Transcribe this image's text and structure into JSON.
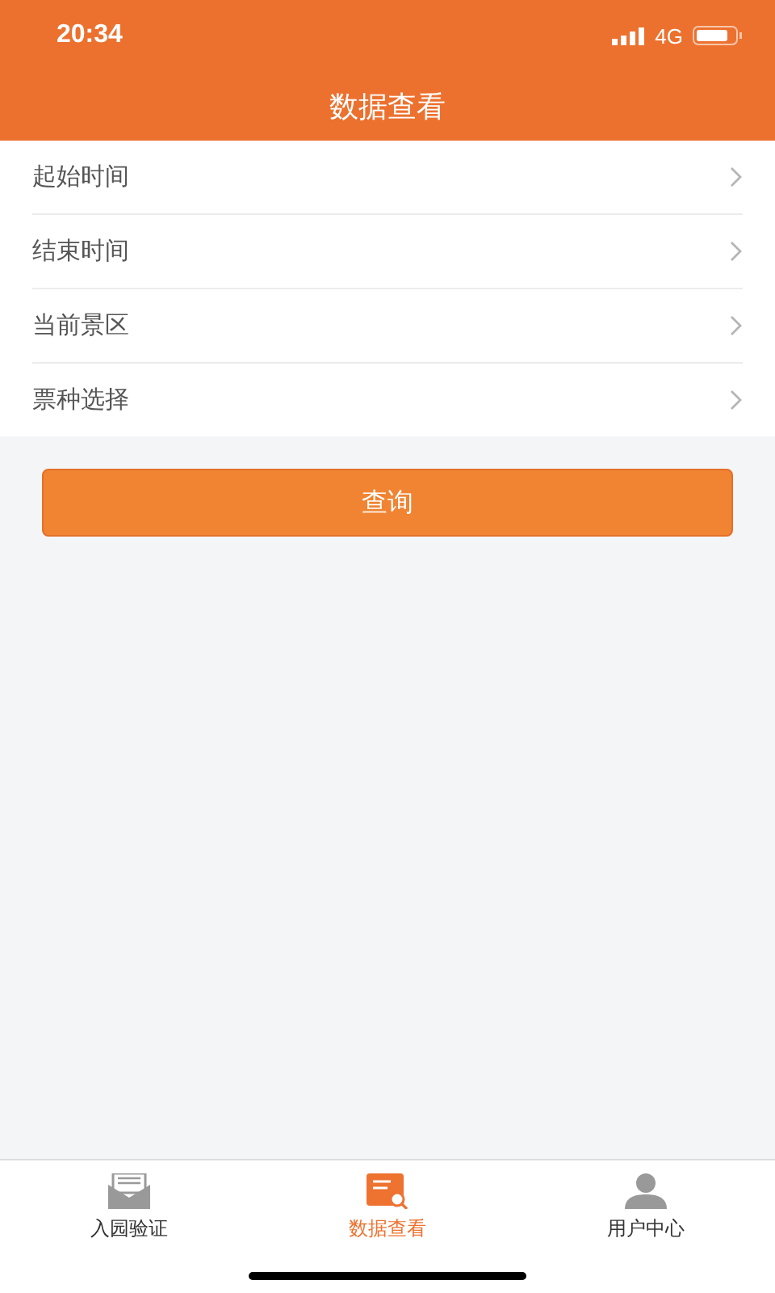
{
  "status_bar": {
    "time": "20:34",
    "network": "4G"
  },
  "header": {
    "title": "数据查看"
  },
  "rows": [
    {
      "label": "起始时间"
    },
    {
      "label": "结束时间"
    },
    {
      "label": "当前景区"
    },
    {
      "label": "票种选择"
    }
  ],
  "query_button": "查询",
  "tabs": [
    {
      "kind": "envelope",
      "label": "入园验证",
      "selected": false
    },
    {
      "kind": "search",
      "label": "数据查看",
      "selected": true
    },
    {
      "kind": "user",
      "label": "用户中心",
      "selected": false
    }
  ]
}
